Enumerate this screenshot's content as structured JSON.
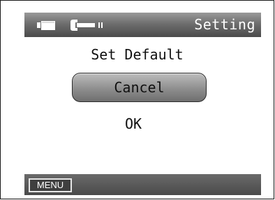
{
  "header": {
    "title": "Setting",
    "icons": [
      "video-camera-icon",
      "wrench-icon"
    ]
  },
  "dialog": {
    "title": "Set Default",
    "options": [
      {
        "label": "Cancel",
        "selected": true
      },
      {
        "label": "OK",
        "selected": false
      }
    ]
  },
  "footer": {
    "menu_label": "MENU"
  }
}
